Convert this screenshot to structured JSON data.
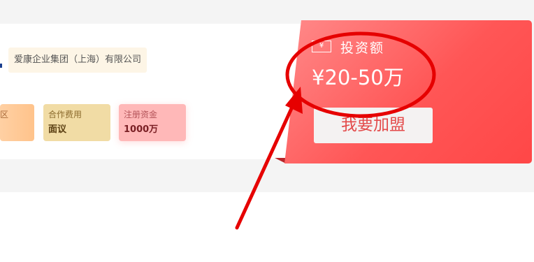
{
  "company": {
    "name": "爱康企业集团（上海）有限公司"
  },
  "stats": [
    {
      "label": "区",
      "value": ""
    },
    {
      "label": "合作费用",
      "value": "面议"
    },
    {
      "label": "注册资金",
      "value": "1000万"
    }
  ],
  "invest": {
    "icon_text": "¥",
    "label": "投资额",
    "amount": "¥20-50万",
    "button": "我要加盟"
  },
  "colors": {
    "panel_red": "#ff5656",
    "annotation_red": "#e60000",
    "button_text": "#e34a4a"
  },
  "icons": {
    "money": "banknote-icon"
  }
}
